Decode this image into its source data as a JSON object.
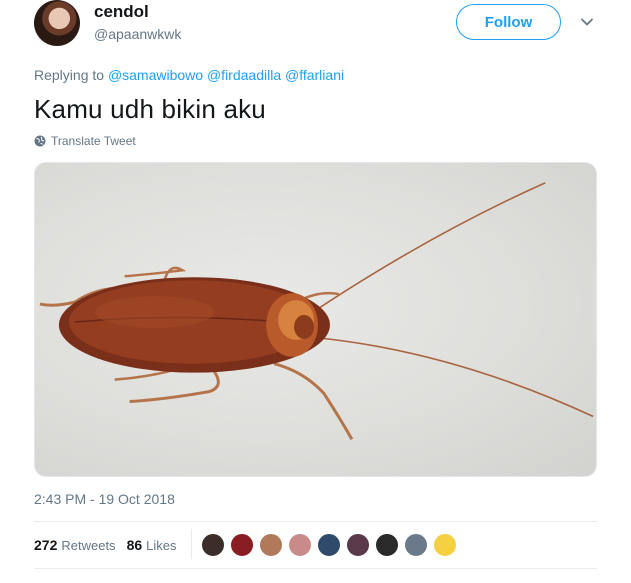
{
  "user": {
    "name": "cendol",
    "handle": "@apaanwkwk"
  },
  "follow_label": "Follow",
  "replying": {
    "prefix": "Replying to",
    "mentions": [
      "@samawibowo",
      "@firdaadilla",
      "@ffarliani"
    ]
  },
  "tweet_text": "Kamu udh bikin aku",
  "translate_label": "Translate Tweet",
  "timestamp": "2:43 PM - 19 Oct 2018",
  "stats": {
    "retweets_count": "272",
    "retweets_label": "Retweets",
    "likes_count": "86",
    "likes_label": "Likes"
  },
  "liker_avatar_colors": [
    "#3b2e2a",
    "#8a1c24",
    "#b07a5a",
    "#c98a8a",
    "#2f4a6b",
    "#5a3a4a",
    "#2a2a2a",
    "#6b7a8a",
    "#f5d142"
  ],
  "colors": {
    "accent": "#1da1f2",
    "secondary_text": "#657786"
  },
  "icons": {
    "caret": "chevron-down-icon",
    "globe": "globe-icon"
  }
}
